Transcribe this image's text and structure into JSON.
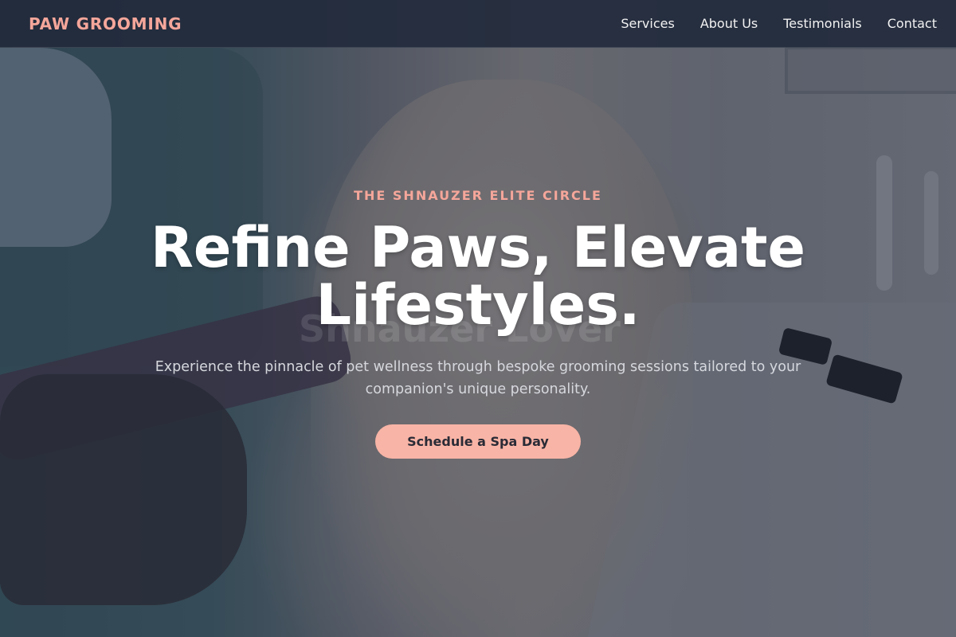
{
  "brand": {
    "name": "PAW GROOMING"
  },
  "nav": {
    "links": [
      "Services",
      "About Us",
      "Testimonials",
      "Contact"
    ]
  },
  "hero": {
    "eyebrow": "THE SHNAUZER ELITE CIRCLE",
    "headline": "Refine Paws, Elevate Lifestyles.",
    "subtext": "Experience the pinnacle of pet wellness through bespoke grooming sessions tailored to your companion's unique personality.",
    "cta_label": "Schedule a Spa Day",
    "background_watermark": "Shnauzer Lover"
  },
  "colors": {
    "accent": "#f5a69a",
    "cta_background": "#f8b4a6",
    "nav_background": "#222a3c",
    "overlay": "#242c40"
  }
}
